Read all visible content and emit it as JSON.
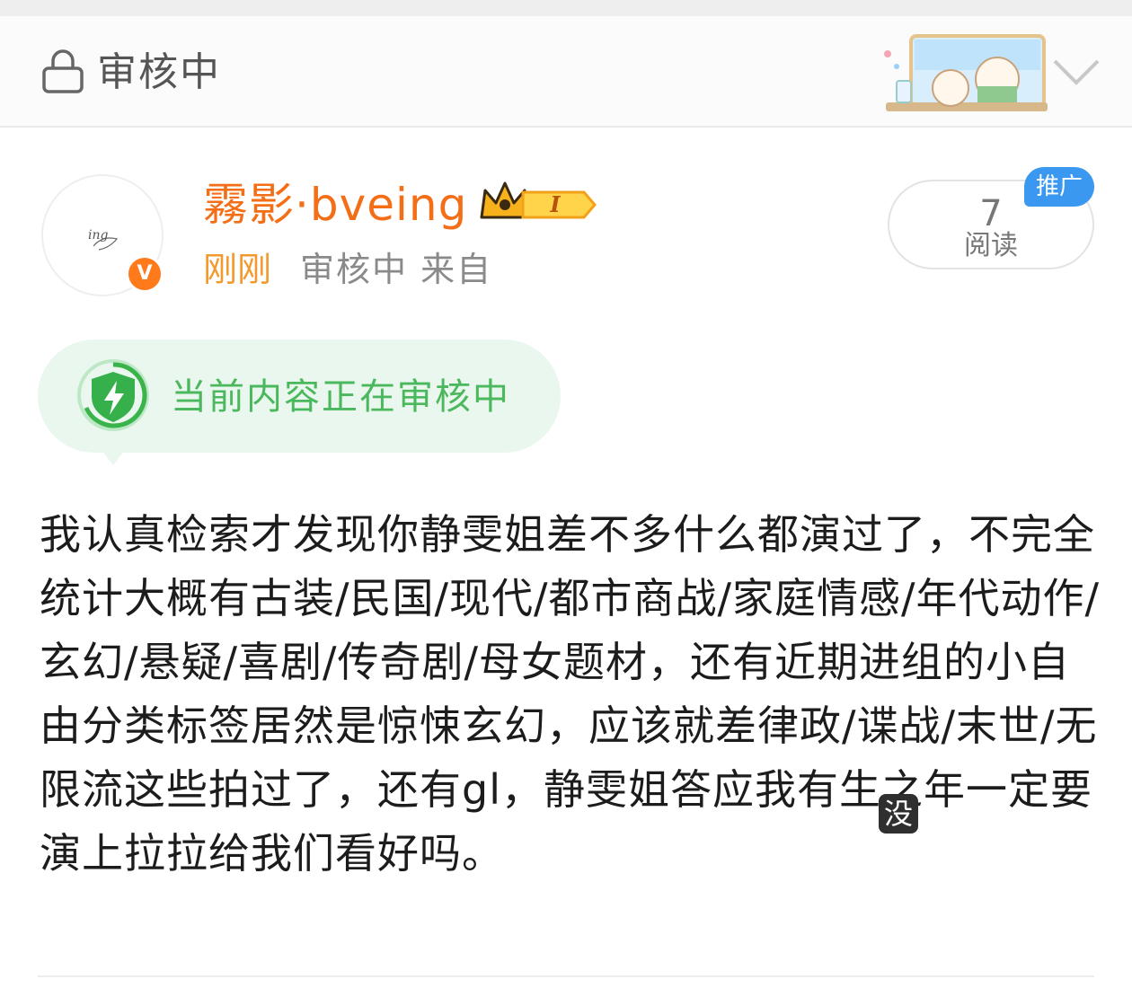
{
  "status_bar": {
    "title": "审核中"
  },
  "author": {
    "avatar_text": "ing",
    "verified_mark": "V",
    "name": "霧影·bveing",
    "level_badge": "I",
    "time": "刚刚",
    "meta": "审核中 来自"
  },
  "stats": {
    "read_count": "7",
    "read_label": "阅读",
    "promo_label": "推广"
  },
  "review_notice": {
    "text": "当前内容正在审核中"
  },
  "post": {
    "body": "我认真检索才发现你静雯姐差不多什么都演过了，不完全统计大概有古装/民国/现代/都市商战/家庭情感/年代动作/玄幻/悬疑/喜剧/传奇剧/母女题材，还有近期进组的小自由分类标签居然是惊悚玄幻，应该就差律政/谍战/末世/无限流这些拍过了，还有gl，静雯姐答应我有生之年一定要演上拉拉给我们看好吗。",
    "float_tag": "没"
  },
  "colors": {
    "username": "#f36e16",
    "time": "#f39a2d",
    "review_green": "#4bb85d",
    "promo_blue": "#3b98f0",
    "verified_orange": "#ff7a1a"
  },
  "icons": [
    "lock-icon",
    "chevron-down-icon",
    "crown-icon",
    "shield-icon",
    "verified-icon"
  ]
}
